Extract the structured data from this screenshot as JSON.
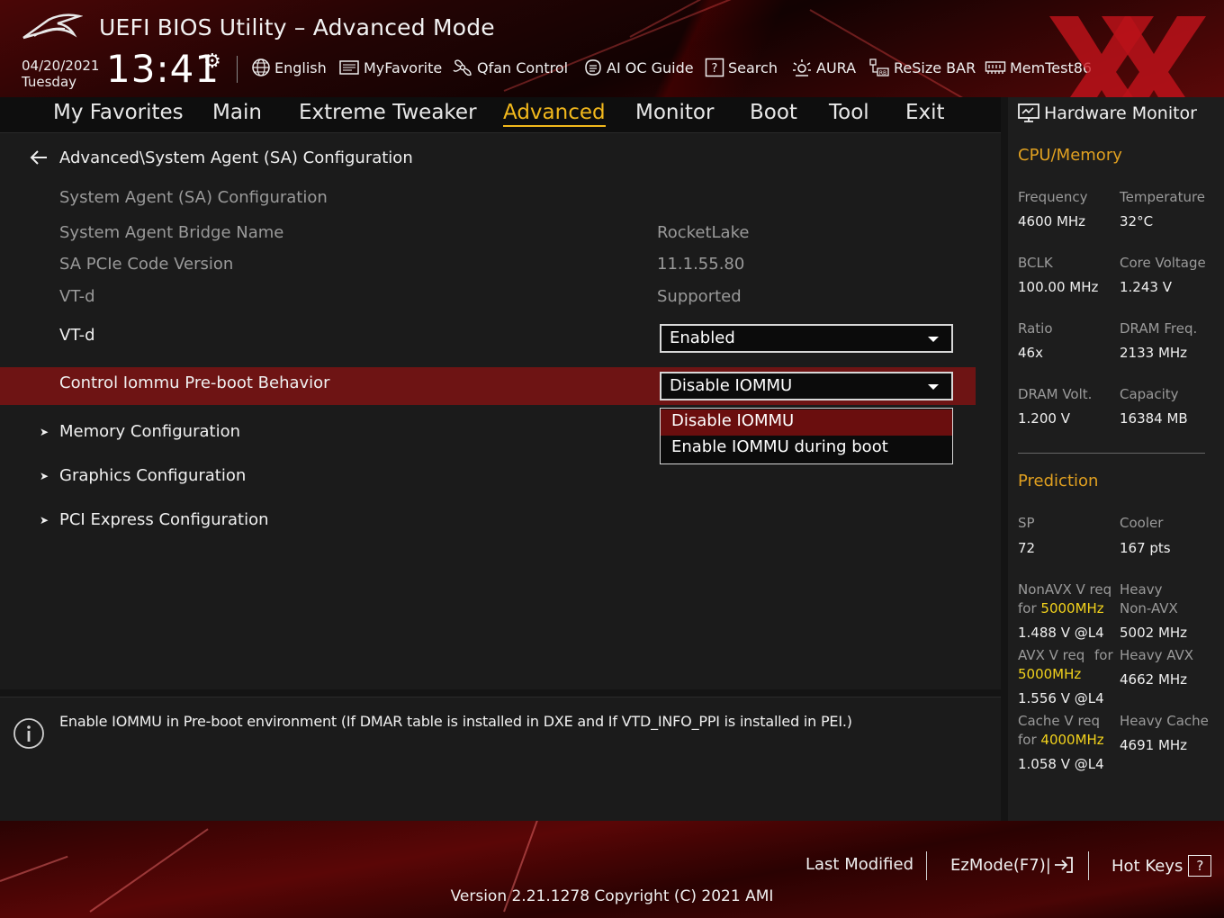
{
  "header": {
    "title": "UEFI BIOS Utility – Advanced Mode",
    "date": "04/20/2021",
    "day": "Tuesday",
    "time": "13:41",
    "tools": [
      {
        "label": "English",
        "icon": "globe-icon"
      },
      {
        "label": "MyFavorite",
        "icon": "favorite-icon"
      },
      {
        "label": "Qfan Control",
        "icon": "fan-icon"
      },
      {
        "label": "AI OC Guide",
        "icon": "ai-guide-icon"
      },
      {
        "label": "Search",
        "icon": "help-box-icon"
      },
      {
        "label": "AURA",
        "icon": "aura-icon"
      },
      {
        "label": "ReSize BAR",
        "icon": "resize-bar-icon"
      },
      {
        "label": "MemTest86",
        "icon": "memory-icon"
      }
    ]
  },
  "nav": {
    "tabs": [
      "My Favorites",
      "Main",
      "Extreme Tweaker",
      "Advanced",
      "Monitor",
      "Boot",
      "Tool",
      "Exit"
    ],
    "active": "Advanced"
  },
  "main": {
    "breadcrumb": "Advanced\\System Agent (SA) Configuration",
    "rows": [
      {
        "label": "System Agent (SA) Configuration",
        "value": ""
      },
      {
        "label": "System Agent Bridge Name",
        "value": "RocketLake"
      },
      {
        "label": "SA PCIe Code Version",
        "value": "11.1.55.80"
      },
      {
        "label": "VT-d",
        "value": "Supported"
      }
    ],
    "vtd": {
      "label": "VT-d",
      "selected": "Enabled"
    },
    "iommu": {
      "label": "Control Iommu Pre-boot Behavior",
      "selected": "Disable IOMMU",
      "options": [
        "Disable IOMMU",
        "Enable IOMMU during boot"
      ]
    },
    "submenus": [
      "Memory Configuration",
      "Graphics Configuration",
      "PCI Express Configuration"
    ]
  },
  "help": {
    "text": "Enable IOMMU in Pre-boot environment (If DMAR table is installed in DXE and If VTD_INFO_PPI is installed in PEI.)"
  },
  "hwmon": {
    "title": "Hardware Monitor",
    "cpu_memory": {
      "section": "CPU/Memory",
      "frequency": {
        "label": "Frequency",
        "value": "4600 MHz"
      },
      "temperature": {
        "label": "Temperature",
        "value": "32°C"
      },
      "bclk": {
        "label": "BCLK",
        "value": "100.00 MHz"
      },
      "core_voltage": {
        "label": "Core Voltage",
        "value": "1.243 V"
      },
      "ratio": {
        "label": "Ratio",
        "value": "46x"
      },
      "dram_freq": {
        "label": "DRAM Freq.",
        "value": "2133 MHz"
      },
      "dram_volt": {
        "label": "DRAM Volt.",
        "value": "1.200 V"
      },
      "capacity": {
        "label": "Capacity",
        "value": "16384 MB"
      }
    },
    "prediction": {
      "section": "Prediction",
      "sp": {
        "label": "SP",
        "value": "72"
      },
      "cooler": {
        "label": "Cooler",
        "value": "167 pts"
      },
      "nonavx": {
        "label1": "NonAVX V req",
        "label2a": "for ",
        "freq": "5000MHz",
        "value": "1.488 V @L4"
      },
      "heavy_nonavx": {
        "label1": "Heavy",
        "label2": "Non-AVX",
        "value": "5002 MHz"
      },
      "avx": {
        "label1a": "AVX V req",
        "label1b": "for",
        "freq": "5000MHz",
        "value": "1.556 V @L4"
      },
      "heavy_avx": {
        "label": "Heavy AVX",
        "value": "4662 MHz"
      },
      "cache": {
        "label1": "Cache V req",
        "label2a": "for ",
        "freq": "4000MHz",
        "value": "1.058 V @L4"
      },
      "heavy_cache": {
        "label": "Heavy Cache",
        "value": "4691 MHz"
      }
    }
  },
  "footer": {
    "last_modified": "Last Modified",
    "ezmode": "EzMode(F7)|",
    "hotkeys": "Hot Keys",
    "hotkeys_key": "?",
    "version": "Version 2.21.1278 Copyright (C) 2021 AMI"
  },
  "colors": {
    "accent": "#f2b81c",
    "highlight_row": "#6e1414",
    "hw_section": "#e0a020",
    "freq_highlight": "#f2d21c"
  }
}
